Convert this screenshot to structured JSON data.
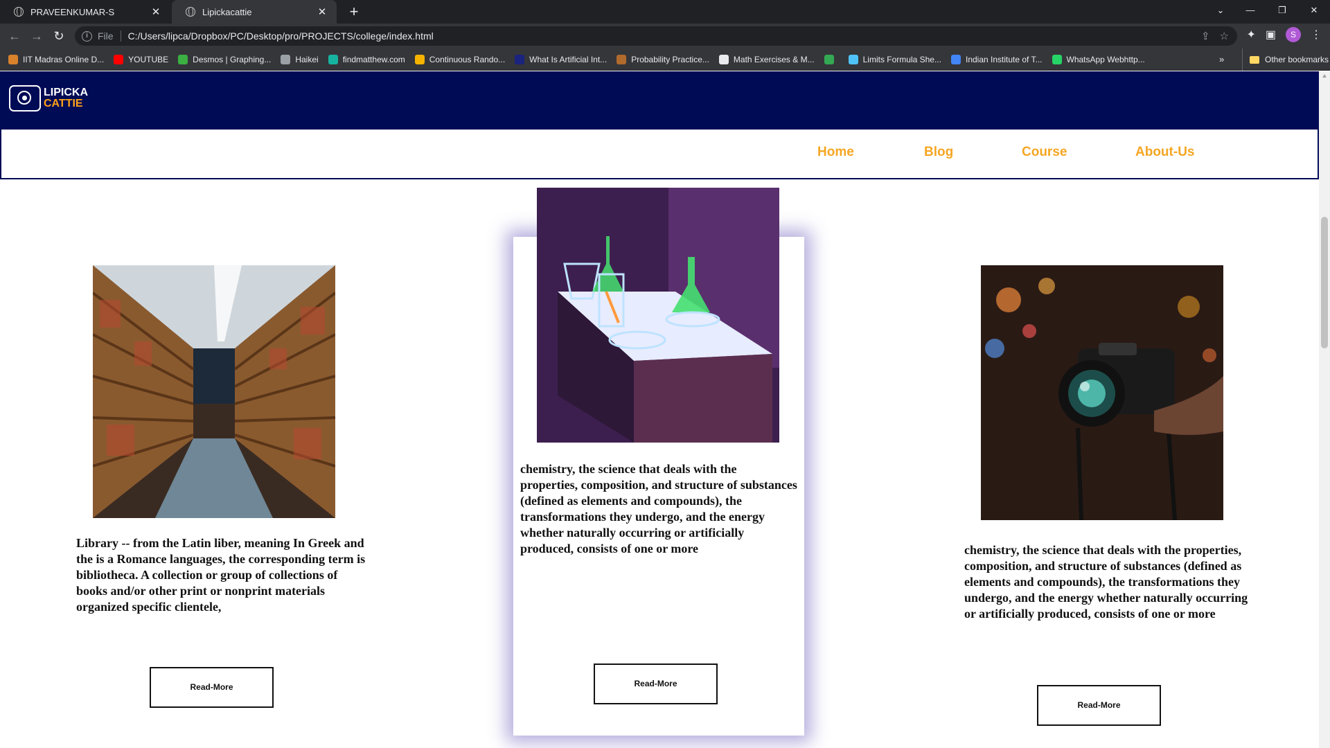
{
  "browser": {
    "tabs": [
      {
        "title": "PRAVEENKUMAR-S",
        "active": false
      },
      {
        "title": "Lipickacattie",
        "active": true
      }
    ],
    "scheme": "File",
    "url": "C:/Users/lipca/Dropbox/PC/Desktop/pro/PROJECTS/college/index.html",
    "profile_initial": "S",
    "bookmarks": [
      {
        "label": "IIT Madras Online D...",
        "color": "#d9822b"
      },
      {
        "label": "YOUTUBE",
        "color": "#ff0000"
      },
      {
        "label": "Desmos | Graphing...",
        "color": "#3cb043"
      },
      {
        "label": "Haikei",
        "color": "#9aa0a6"
      },
      {
        "label": "findmatthew.com",
        "color": "#16b4a0"
      },
      {
        "label": "Continuous Rando...",
        "color": "#f4b400"
      },
      {
        "label": "What Is Artificial Int...",
        "color": "#1a237e"
      },
      {
        "label": "Probability Practice...",
        "color": "#b06a2c"
      },
      {
        "label": "Math Exercises & M...",
        "color": "#e8eaed"
      },
      {
        "label": "",
        "color": "#34a853"
      },
      {
        "label": "Limits Formula She...",
        "color": "#4fc3f7"
      },
      {
        "label": "Indian Institute of T...",
        "color": "#4285f4"
      },
      {
        "label": "WhatsApp Webhttp...",
        "color": "#25d366"
      }
    ],
    "other_bookmarks": "Other bookmarks"
  },
  "site": {
    "logo_line1": "LIPICKA",
    "logo_line2": "CATTIE",
    "nav": [
      "Home",
      "Blog",
      "Course",
      "About-Us"
    ],
    "nav_color": "#f5a623",
    "header_color": "#000b55"
  },
  "cards": [
    {
      "image": "library-photo",
      "text": "Library -- from the Latin liber, meaning In Greek and the is a Romance languages, the corresponding term is bibliotheca. A collection or group of collections of books and/or other print or nonprint materials organized specific clientele,",
      "button": "Read-More"
    },
    {
      "image": "chemistry-lab-photo",
      "text": "chemistry, the science that deals with the properties, composition, and structure of substances (defined as elements and compounds), the transformations they undergo, and the energy whether naturally occurring or artificially produced, consists of one or more",
      "button": "Read-More"
    },
    {
      "image": "camera-photo",
      "text": "chemistry, the science that deals with the properties, composition, and structure of substances (defined as elements and compounds), the transformations they undergo, and the energy whether naturally occurring or artificially produced, consists of one or more",
      "button": "Read-More"
    }
  ]
}
